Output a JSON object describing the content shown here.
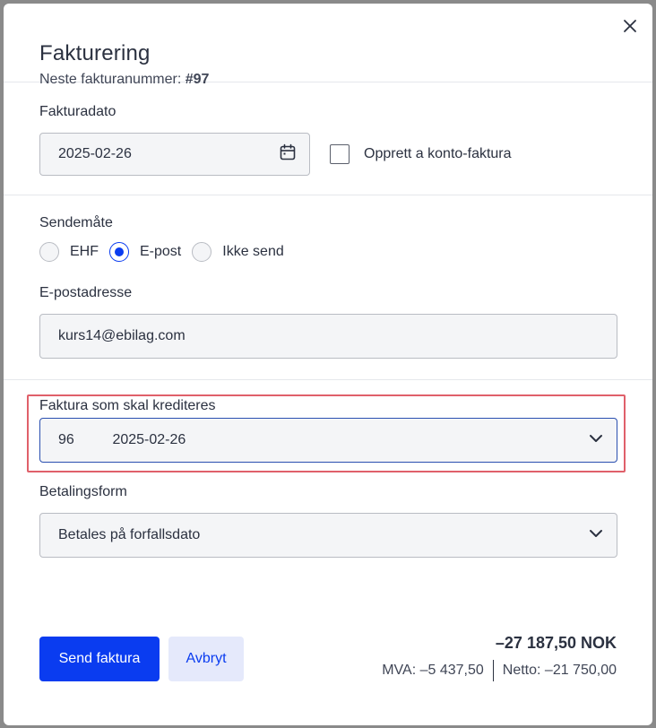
{
  "header": {
    "title": "Fakturering",
    "subtitle_prefix": "Neste fakturanummer:",
    "subtitle_number": "#97"
  },
  "invoice_date": {
    "label": "Fakturadato",
    "value": "2025-02-26",
    "a_konto_label": "Opprett a konto-faktura",
    "a_konto_checked": false
  },
  "send_method": {
    "label": "Sendemåte",
    "options": [
      "EHF",
      "E-post",
      "Ikke send"
    ],
    "selected": "E-post"
  },
  "email": {
    "label": "E-postadresse",
    "value": "kurs14@ebilag.com"
  },
  "credit_invoice": {
    "label": "Faktura som skal krediteres",
    "number": "96",
    "date": "2025-02-26"
  },
  "payment": {
    "label": "Betalingsform",
    "value": "Betales på forfallsdato"
  },
  "actions": {
    "send_label": "Send faktura",
    "cancel_label": "Avbryt"
  },
  "totals": {
    "total": "–27 187,50 NOK",
    "vat": "MVA: –5 437,50",
    "net": "Netto: –21 750,00"
  },
  "colors": {
    "accent": "#0a3cf0",
    "highlight_border": "#e0606a"
  },
  "icons": [
    "close-icon",
    "calendar-icon",
    "chevron-down-icon"
  ]
}
